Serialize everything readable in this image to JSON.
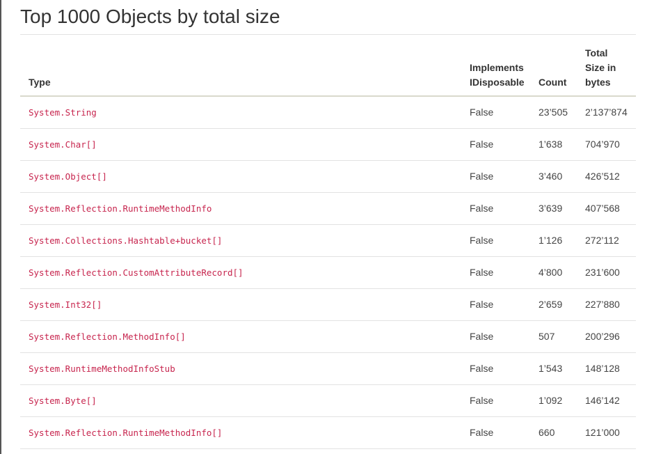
{
  "page": {
    "title": "Top 1000 Objects by total size"
  },
  "table": {
    "headers": {
      "type": "Type",
      "implements_line1": "Implements",
      "implements_line2": "IDisposable",
      "count": "Count",
      "size_line1": "Total",
      "size_line2": "Size in",
      "size_line3": "bytes"
    },
    "rows": [
      {
        "type": "System.String",
        "disposable": "False",
        "count": "23’505",
        "size": "2’137’874"
      },
      {
        "type": "System.Char[]",
        "disposable": "False",
        "count": "1’638",
        "size": "704’970"
      },
      {
        "type": "System.Object[]",
        "disposable": "False",
        "count": "3’460",
        "size": "426’512"
      },
      {
        "type": "System.Reflection.RuntimeMethodInfo",
        "disposable": "False",
        "count": "3’639",
        "size": "407’568"
      },
      {
        "type": "System.Collections.Hashtable+bucket[]",
        "disposable": "False",
        "count": "1’126",
        "size": "272’112"
      },
      {
        "type": "System.Reflection.CustomAttributeRecord[]",
        "disposable": "False",
        "count": "4’800",
        "size": "231’600"
      },
      {
        "type": "System.Int32[]",
        "disposable": "False",
        "count": "2’659",
        "size": "227’880"
      },
      {
        "type": "System.Reflection.MethodInfo[]",
        "disposable": "False",
        "count": "507",
        "size": "200’296"
      },
      {
        "type": "System.RuntimeMethodInfoStub",
        "disposable": "False",
        "count": "1’543",
        "size": "148’128"
      },
      {
        "type": "System.Byte[]",
        "disposable": "False",
        "count": "1’092",
        "size": "146’142"
      },
      {
        "type": "System.Reflection.RuntimeMethodInfo[]",
        "disposable": "False",
        "count": "660",
        "size": "121’000"
      }
    ]
  },
  "colors": {
    "type_text": "#c7254e",
    "body_text": "#333333",
    "row_border": "#e2e2e2"
  }
}
